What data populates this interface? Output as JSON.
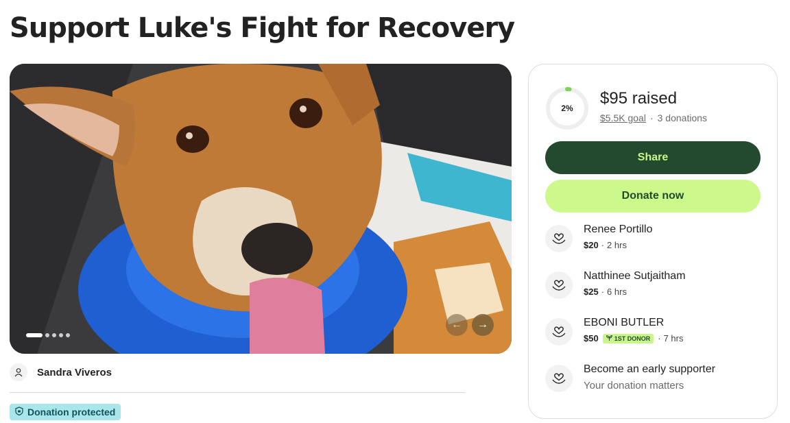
{
  "campaign": {
    "title": "Support Luke's Fight for Recovery",
    "organizer": "Sandra Viveros",
    "protected_label": "Donation protected"
  },
  "gallery": {
    "slide_count": 5,
    "active_slide": 1,
    "prev_icon": "arrow-left-icon",
    "next_icon": "arrow-right-icon"
  },
  "progress": {
    "percent_label": "2%",
    "percent_value": 0.02,
    "raised": "$95 raised",
    "goal": "$5.5K goal",
    "donations": "3 donations"
  },
  "buttons": {
    "share": "Share",
    "donate": "Donate now"
  },
  "donors": [
    {
      "name": "Renee Portillo",
      "amount": "$20",
      "time": "2 hrs",
      "badge": ""
    },
    {
      "name": "Natthinee Sutjaitham",
      "amount": "$25",
      "time": "6 hrs",
      "badge": ""
    },
    {
      "name": "EBONI BUTLER",
      "amount": "$50",
      "time": "7 hrs",
      "badge": "1ST DONOR"
    }
  ],
  "early_supporter": {
    "title": "Become an early supporter",
    "subtitle": "Your donation matters"
  },
  "colors": {
    "share_bg": "#244a2e",
    "donate_bg": "#cdf88c",
    "ring_progress": "#7cd35a",
    "protected_bg": "#a8e6ea"
  }
}
